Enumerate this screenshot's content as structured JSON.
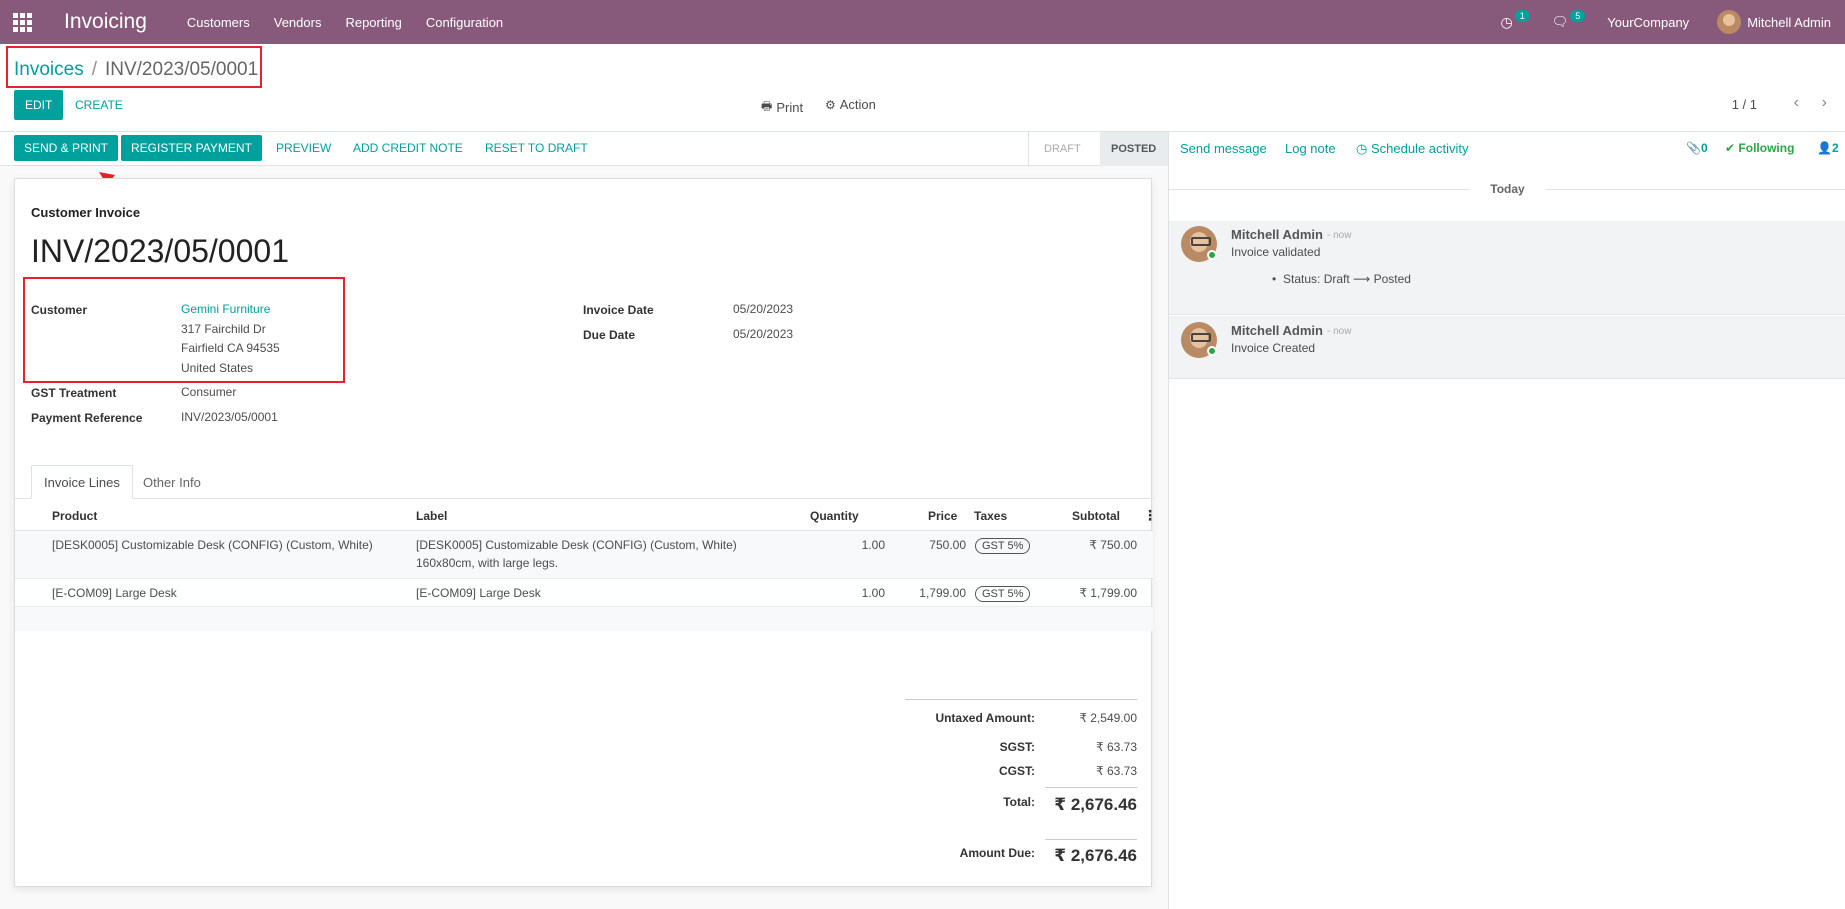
{
  "navbar": {
    "app_title": "Invoicing",
    "menu": [
      "Customers",
      "Vendors",
      "Reporting",
      "Configuration"
    ],
    "activity_count": "1",
    "message_count": "5",
    "company": "YourCompany",
    "user": "Mitchell Admin"
  },
  "breadcrumb": {
    "parent": "Invoices",
    "separator": "/",
    "current": "INV/2023/05/0001"
  },
  "control": {
    "edit_label": "EDIT",
    "create_label": "CREATE",
    "print_label": "Print",
    "action_label": "Action",
    "pager": "1 / 1"
  },
  "statusbar": {
    "send_print": "SEND & PRINT",
    "register_payment": "REGISTER PAYMENT",
    "preview": "PREVIEW",
    "add_credit_note": "ADD CREDIT NOTE",
    "reset_to_draft": "RESET TO DRAFT",
    "stage_draft": "DRAFT",
    "stage_posted": "POSTED"
  },
  "invoice": {
    "subtitle": "Customer Invoice",
    "number": "INV/2023/05/0001",
    "customer_label": "Customer",
    "customer_name": "Gemini Furniture",
    "address_line1": "317 Fairchild Dr",
    "address_line2": "Fairfield CA 94535",
    "address_line3": "United States",
    "gst_label": "GST Treatment",
    "gst_value": "Consumer",
    "payment_ref_label": "Payment Reference",
    "payment_ref_value": "INV/2023/05/0001",
    "invoice_date_label": "Invoice Date",
    "invoice_date": "05/20/2023",
    "due_date_label": "Due Date",
    "due_date": "05/20/2023"
  },
  "tabs": {
    "invoice_lines": "Invoice Lines",
    "other_info": "Other Info"
  },
  "lines": {
    "headers": {
      "product": "Product",
      "label": "Label",
      "quantity": "Quantity",
      "price": "Price",
      "taxes": "Taxes",
      "subtotal": "Subtotal"
    },
    "rows": [
      {
        "product": "[DESK0005] Customizable Desk (CONFIG) (Custom, White)",
        "label_1": "[DESK0005] Customizable Desk (CONFIG) (Custom, White)",
        "label_2": "160x80cm, with large legs.",
        "quantity": "1.00",
        "price": "750.00",
        "tax": "GST 5%",
        "subtotal": "₹ 750.00"
      },
      {
        "product": "[E-COM09] Large Desk",
        "label_1": "[E-COM09] Large Desk",
        "quantity": "1.00",
        "price": "1,799.00",
        "tax": "GST 5%",
        "subtotal": "₹ 1,799.00"
      }
    ]
  },
  "totals": {
    "untaxed_label": "Untaxed Amount:",
    "untaxed_value": "₹ 2,549.00",
    "sgst_label": "SGST:",
    "sgst_value": "₹ 63.73",
    "cgst_label": "CGST:",
    "cgst_value": "₹ 63.73",
    "total_label": "Total:",
    "total_value": "₹ 2,676.46",
    "due_label": "Amount Due:",
    "due_value": "₹ 2,676.46"
  },
  "chatter": {
    "send_message": "Send message",
    "log_note": "Log note",
    "schedule_activity": "Schedule activity",
    "attachments": "0",
    "following": "Following",
    "followers": "2",
    "today": "Today",
    "messages": [
      {
        "author": "Mitchell Admin",
        "date": "- now",
        "body": "Invoice validated",
        "tracking": "Status: Draft ⟶ Posted"
      },
      {
        "author": "Mitchell Admin",
        "date": "- now",
        "body": "Invoice Created"
      }
    ]
  },
  "colors": {
    "navbar": "#875a7b",
    "primary": "#00a09d",
    "annotation_red": "#e8212b"
  }
}
